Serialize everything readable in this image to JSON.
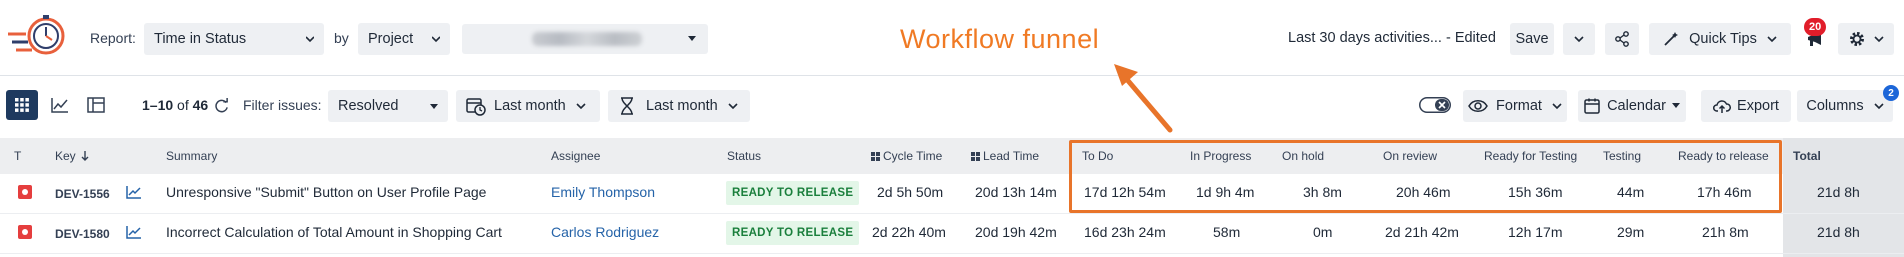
{
  "header": {
    "report_label": "Report:",
    "report_value": "Time in Status",
    "by_label": "by",
    "group_value": "Project",
    "saved_view": "Last 30 days activities... - Edited",
    "save_label": "Save",
    "quick_tips_label": "Quick Tips",
    "notifications_count": "20"
  },
  "annotation": {
    "text": "Workflow funnel",
    "color": "#f07a24"
  },
  "filters": {
    "range_text": "1–10",
    "of_text": "of",
    "total_text": "46",
    "filter_label": "Filter issues:",
    "filter_value": "Resolved",
    "date_filter_1": "Last month",
    "date_filter_2": "Last month",
    "format_label": "Format",
    "calendar_label": "Calendar",
    "export_label": "Export",
    "columns_label": "Columns",
    "columns_badge": "2"
  },
  "table": {
    "headers": {
      "type": "T",
      "key": "Key",
      "summary": "Summary",
      "assignee": "Assignee",
      "status": "Status",
      "cycle_time": "Cycle Time",
      "lead_time": "Lead Time",
      "to_do": "To Do",
      "in_progress": "In Progress",
      "on_hold": "On hold",
      "on_review": "On review",
      "ready_testing": "Ready for Testing",
      "testing": "Testing",
      "ready_release": "Ready to release",
      "total": "Total"
    },
    "rows": [
      {
        "key": "DEV-1556",
        "summary": "Unresponsive \"Submit\" Button on User Profile Page",
        "assignee": "Emily Thompson",
        "status": "READY TO RELEASE",
        "cycle_time": "2d 5h 50m",
        "lead_time": "20d 13h 14m",
        "to_do": "17d 12h 54m",
        "in_progress": "1d 9h 4m",
        "on_hold": "3h 8m",
        "on_review": "20h 46m",
        "ready_testing": "15h 36m",
        "testing": "44m",
        "ready_release": "17h 46m",
        "total": "21d 8h"
      },
      {
        "key": "DEV-1580",
        "summary": "Incorrect Calculation of Total Amount in Shopping Cart",
        "assignee": "Carlos Rodriguez",
        "status": "READY TO RELEASE",
        "cycle_time": "2d 22h 40m",
        "lead_time": "20d 19h 42m",
        "to_do": "16d 23h 24m",
        "in_progress": "58m",
        "on_hold": "0m",
        "on_review": "2d 21h 42m",
        "ready_testing": "12h 17m",
        "testing": "29m",
        "ready_release": "21h 8m",
        "total": "21d 8h"
      }
    ]
  }
}
